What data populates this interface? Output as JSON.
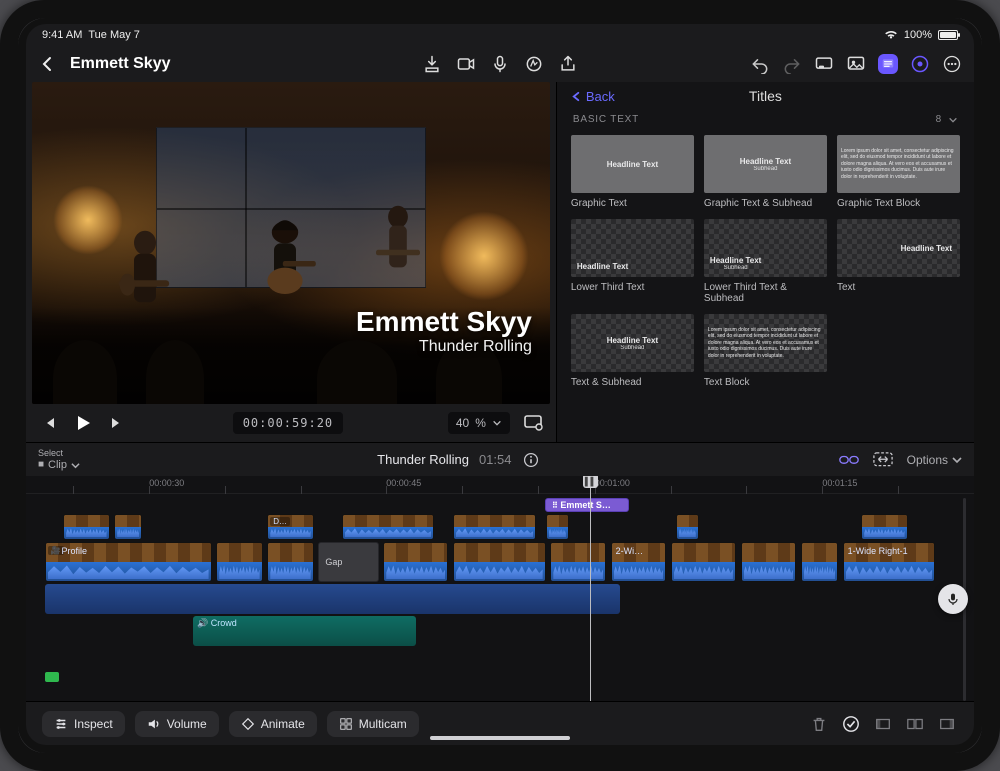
{
  "status": {
    "time": "9:41 AM",
    "date": "Tue May 7",
    "battery_pct": "100%"
  },
  "header": {
    "project_title": "Emmett Skyy"
  },
  "viewer": {
    "overlay_title": "Emmett Skyy",
    "overlay_subtitle": "Thunder Rolling",
    "timecode": "00:00:59:20",
    "zoom": "40",
    "zoom_unit": "%"
  },
  "browser": {
    "back_label": "Back",
    "title": "Titles",
    "section": "BASIC TEXT",
    "section_count": "8",
    "sample_headline": "Headline Text",
    "sample_subhead": "Subhead",
    "lorem": "Lorem ipsum dolor sit amet, consectetur adipiscing elit, sed do eiusmod tempor incididunt ut labore et dolore magna aliqua. At vero eos et accusamus et iusto odio dignissimos ducimus. Duis aute irure dolor in reprehenderit in voluptate.",
    "tiles": [
      {
        "caption": "Graphic Text"
      },
      {
        "caption": "Graphic Text & Subhead"
      },
      {
        "caption": "Graphic Text Block"
      },
      {
        "caption": "Lower Third Text"
      },
      {
        "caption": "Lower Third Text & Subhead"
      },
      {
        "caption": "Text"
      },
      {
        "caption": "Text & Subhead"
      },
      {
        "caption": "Text Block"
      }
    ]
  },
  "timeline_header": {
    "select_label": "Select",
    "clip_label": "Clip",
    "clip_name": "Thunder Rolling",
    "clip_duration": "01:54",
    "options_label": "Options"
  },
  "timeline": {
    "ruler": [
      "00:00:30",
      "00:00:45",
      "00:01:00",
      "00:01:15"
    ],
    "title_clip_label": "Emmett S…",
    "labels": {
      "profile": "Profile",
      "gap": "Gap",
      "wide": "2-Wi…",
      "wide_right": "1-Wide Right-1",
      "crowd": "Crowd",
      "d_badge": "D…"
    }
  },
  "toolbar": {
    "inspect": "Inspect",
    "volume": "Volume",
    "animate": "Animate",
    "multicam": "Multicam"
  }
}
